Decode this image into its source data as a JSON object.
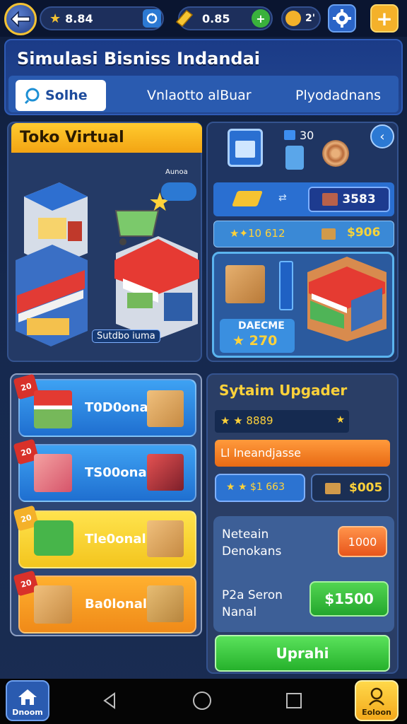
{
  "topbar": {
    "stars": "8.84",
    "gold": "0.85",
    "gems": "2'"
  },
  "header": {
    "title": "Simulasi Bisniss Indandai",
    "tabs": [
      {
        "label": "Solhe"
      },
      {
        "label": "Vnlaotto alBuar"
      },
      {
        "label": "Plyodadnans"
      }
    ]
  },
  "toko": {
    "title": "Toko Virtual",
    "badge": "Aunoa",
    "store_label": "Sutdbo iuma"
  },
  "stats_panel": {
    "counter": "30",
    "price_box": "3583",
    "row2_stat": "★✦10 612",
    "row2_money": "$906",
    "shop_label": "DAECME",
    "shop_value": "★ 270"
  },
  "categories": [
    {
      "label": "T0D0onal",
      "ribbon": "20",
      "color": "blue"
    },
    {
      "label": "TS00onal",
      "ribbon": "20",
      "color": "blue"
    },
    {
      "label": "Tle0onal",
      "ribbon": "20",
      "color": "yellow"
    },
    {
      "label": "Ba0lonal",
      "ribbon": "20",
      "color": "orange"
    }
  ],
  "upgrade": {
    "title": "Sytaim Upgader",
    "stat_row": "★ ★ 8889",
    "orange_bar": "Ll Ineandjasse",
    "stat_a": "★ ★ $1 663",
    "stat_b": "$005",
    "info1_label": "Neteain\nDenokans",
    "info1_btn": "1000",
    "info2_label": "P2a Seron\nNanal",
    "info2_btn": "$1500",
    "action": "Uprahi"
  },
  "nav": {
    "home": "Dnoom",
    "profile": "Eoloon"
  },
  "colors": {
    "accent_gold": "#f3c233",
    "green": "#38c43a",
    "orange": "#f07a1f"
  }
}
